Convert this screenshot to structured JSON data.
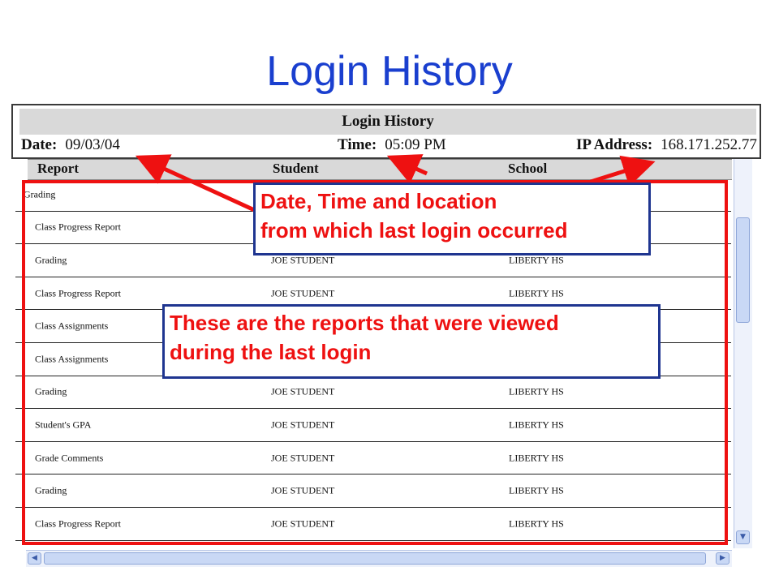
{
  "slide": {
    "title": "Login History"
  },
  "panel": {
    "title": "Login History",
    "date_label": "Date:",
    "date_value": "09/03/04",
    "time_label": "Time:",
    "time_value": "05:09 PM",
    "ip_label": "IP Address:",
    "ip_value": "168.171.252.77"
  },
  "table": {
    "columns": [
      "Report",
      "Student",
      "School"
    ],
    "rows": [
      {
        "report": "Grading",
        "student": "",
        "school": ""
      },
      {
        "report": "Class Progress  Report",
        "student": "",
        "school": ""
      },
      {
        "report": "Grading",
        "student": "JOE STUDENT",
        "school": "LIBERTY HS"
      },
      {
        "report": "Class Progress  Report",
        "student": "JOE STUDENT",
        "school": "LIBERTY HS"
      },
      {
        "report": "Class Assignments",
        "student": "",
        "school": ""
      },
      {
        "report": "Class Assignments",
        "student": "",
        "school": ""
      },
      {
        "report": "Grading",
        "student": "JOE STUDENT",
        "school": "LIBERTY HS"
      },
      {
        "report": "Student's GPA",
        "student": "JOE STUDENT",
        "school": "LIBERTY HS"
      },
      {
        "report": "Grade Comments",
        "student": "JOE STUDENT",
        "school": "LIBERTY HS"
      },
      {
        "report": "Grading",
        "student": "JOE STUDENT",
        "school": "LIBERTY HS"
      },
      {
        "report": "Class Progress  Report",
        "student": "JOE STUDENT",
        "school": "LIBERTY HS"
      }
    ]
  },
  "callouts": {
    "top": {
      "line1": "Date, Time and location",
      "line2": "from which last login occurred"
    },
    "middle": {
      "line1": "These are the reports that were viewed",
      "line2": "during the last login"
    }
  },
  "icons": {
    "scroll_up": "up-arrow-icon",
    "scroll_down": "down-arrow-icon",
    "scroll_left": "left-arrow-icon",
    "scroll_right": "right-arrow-icon"
  },
  "colors": {
    "title": "#1a3fcf",
    "annotation_red": "#ee1111",
    "callout_border": "#1f3590",
    "header_gray": "#d9d9d9"
  }
}
